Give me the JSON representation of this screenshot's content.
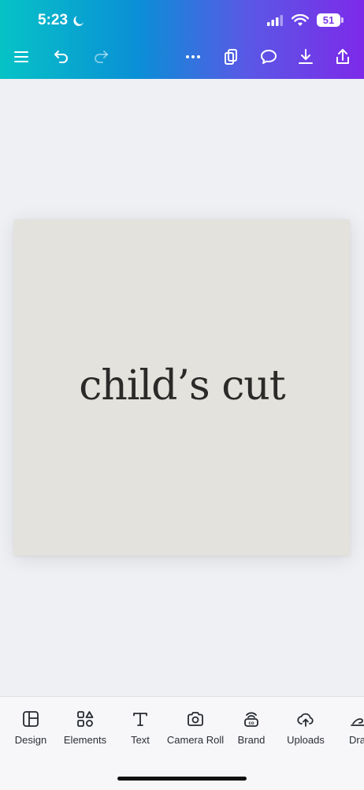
{
  "status_bar": {
    "time": "5:23",
    "battery": "51",
    "icons": [
      "moon-icon",
      "signal-icon",
      "wifi-icon",
      "battery-icon"
    ]
  },
  "toolbar": {
    "buttons": [
      "menu-icon",
      "undo-icon",
      "redo-icon",
      "more-icon",
      "pages-icon",
      "comment-icon",
      "download-icon",
      "share-icon"
    ],
    "gradient": [
      "#06c3c6",
      "#0a8fd6",
      "#5a58e6",
      "#7d2ae8"
    ]
  },
  "canvas": {
    "text": "child’s cut",
    "background": "#e4e2dd",
    "text_color": "#2a2a28"
  },
  "bottom_bar": {
    "items": [
      {
        "label": "Design",
        "icon": "design-icon"
      },
      {
        "label": "Elements",
        "icon": "elements-icon"
      },
      {
        "label": "Text",
        "icon": "text-icon"
      },
      {
        "label": "Camera Roll",
        "icon": "camera-icon"
      },
      {
        "label": "Brand",
        "icon": "brand-icon"
      },
      {
        "label": "Uploads",
        "icon": "uploads-icon"
      },
      {
        "label": "Dra",
        "icon": "draw-icon"
      }
    ]
  }
}
